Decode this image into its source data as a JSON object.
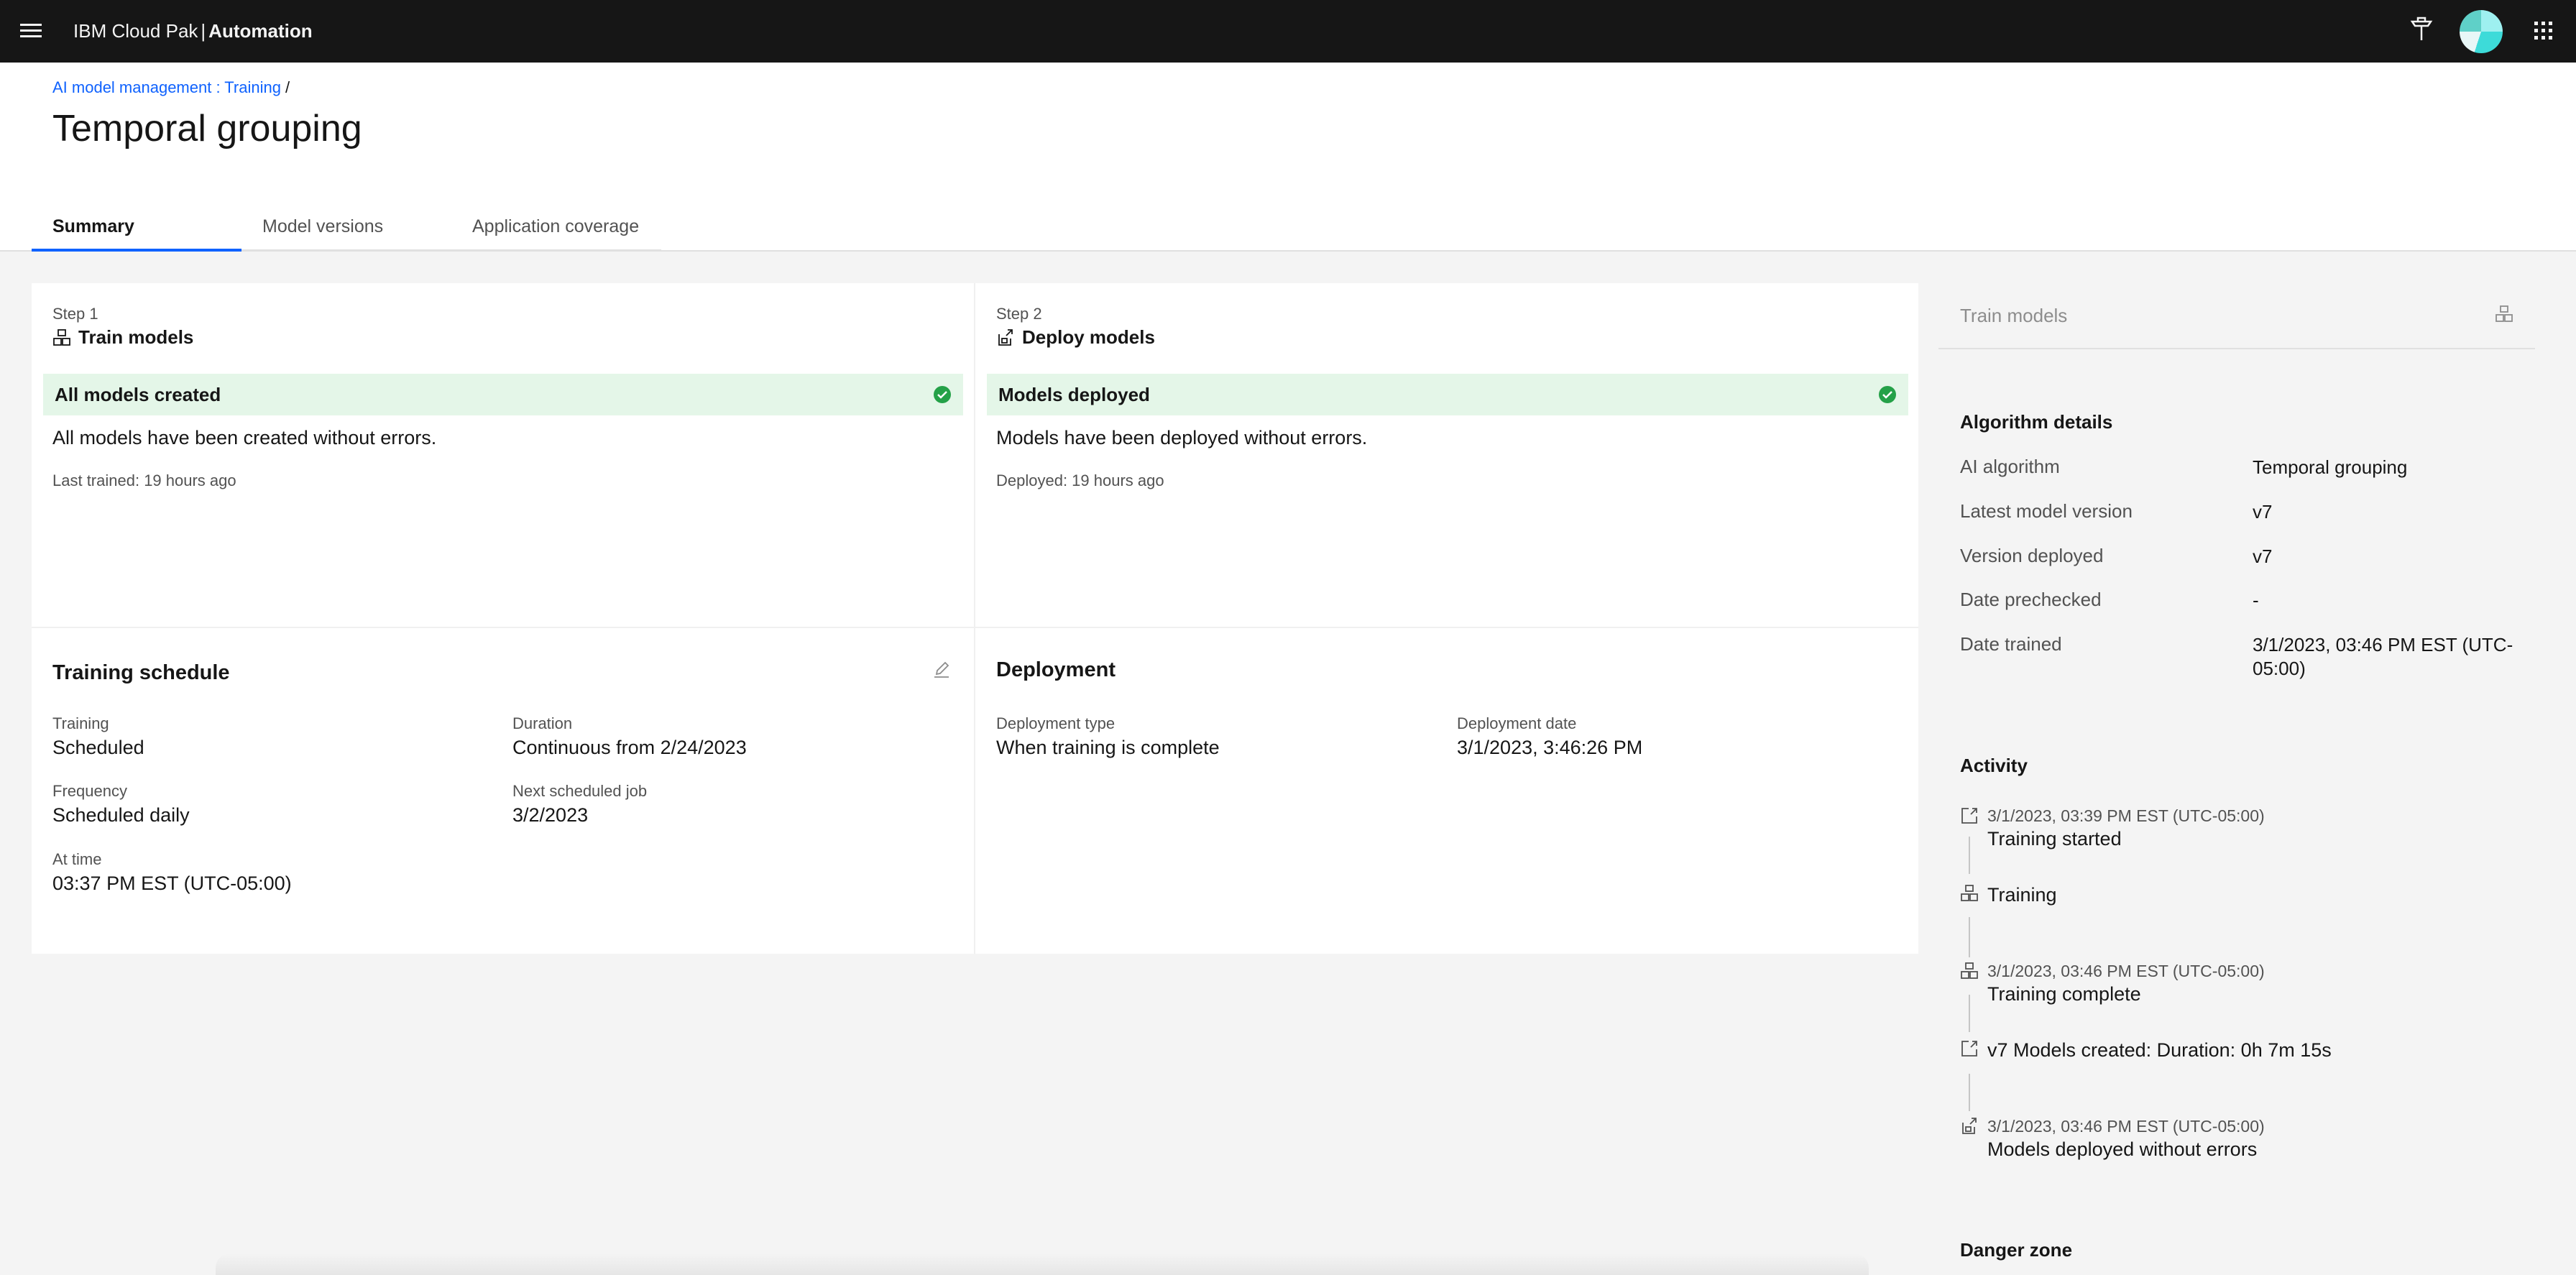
{
  "header": {
    "brand_prefix": "IBM Cloud Pak",
    "brand_sep": "|",
    "brand_product": "Automation",
    "icons": [
      "menu-icon",
      "pin-icon",
      "avatar",
      "app-switcher-icon"
    ]
  },
  "breadcrumb": {
    "link": "AI model management : Training",
    "separator": "/"
  },
  "page": {
    "title": "Temporal grouping"
  },
  "tabs": [
    {
      "label": "Summary",
      "active": true
    },
    {
      "label": "Model versions",
      "active": false
    },
    {
      "label": "Application coverage",
      "active": false
    }
  ],
  "step1": {
    "step": "Step 1",
    "title": "Train models",
    "banner": "All models created",
    "message": "All models have been created without errors.",
    "meta": "Last trained: 19 hours ago"
  },
  "step2": {
    "step": "Step 2",
    "title": "Deploy models",
    "banner": "Models deployed",
    "message": "Models have been deployed without errors.",
    "meta": "Deployed: 19 hours ago"
  },
  "schedule": {
    "title": "Training schedule",
    "training_label": "Training",
    "training_value": "Scheduled",
    "duration_label": "Duration",
    "duration_value": "Continuous from 2/24/2023",
    "frequency_label": "Frequency",
    "frequency_value": "Scheduled daily",
    "next_label": "Next scheduled job",
    "next_value": "3/2/2023",
    "at_time_label": "At time",
    "at_time_value": "03:37 PM EST (UTC-05:00)"
  },
  "deployment": {
    "title": "Deployment",
    "type_label": "Deployment type",
    "type_value": "When training is complete",
    "date_label": "Deployment date",
    "date_value": "3/1/2023, 3:46:26 PM"
  },
  "side_panel": {
    "header": "Train models",
    "algo_title": "Algorithm details",
    "details": [
      {
        "key": "AI algorithm",
        "value": "Temporal grouping"
      },
      {
        "key": "Latest model version",
        "value": "v7"
      },
      {
        "key": "Version deployed",
        "value": "v7"
      },
      {
        "key": "Date prechecked",
        "value": "-"
      },
      {
        "key": "Date trained",
        "value": "3/1/2023, 03:46 PM EST (UTC-05:00)"
      }
    ],
    "activity_title": "Activity",
    "activity": [
      {
        "timestamp": "3/1/2023, 03:39 PM EST (UTC-05:00)",
        "text": "Training started",
        "icon": "start-icon"
      },
      {
        "timestamp": "",
        "text": "Training",
        "icon": "models-icon"
      },
      {
        "timestamp": "3/1/2023, 03:46 PM EST (UTC-05:00)",
        "text": "Training complete",
        "icon": "models-icon"
      },
      {
        "timestamp": "",
        "text": "v7 Models created: Duration: 0h 7m 15s",
        "icon": "start-icon"
      },
      {
        "timestamp": "3/1/2023, 03:46 PM EST (UTC-05:00)",
        "text": "Models deployed without errors",
        "icon": "deploy-icon"
      }
    ],
    "danger_title": "Danger zone"
  },
  "colors": {
    "header_bg": "#161616",
    "link": "#0f62fe",
    "success_bg": "#e4f6e8",
    "success_icon": "#24a148"
  }
}
